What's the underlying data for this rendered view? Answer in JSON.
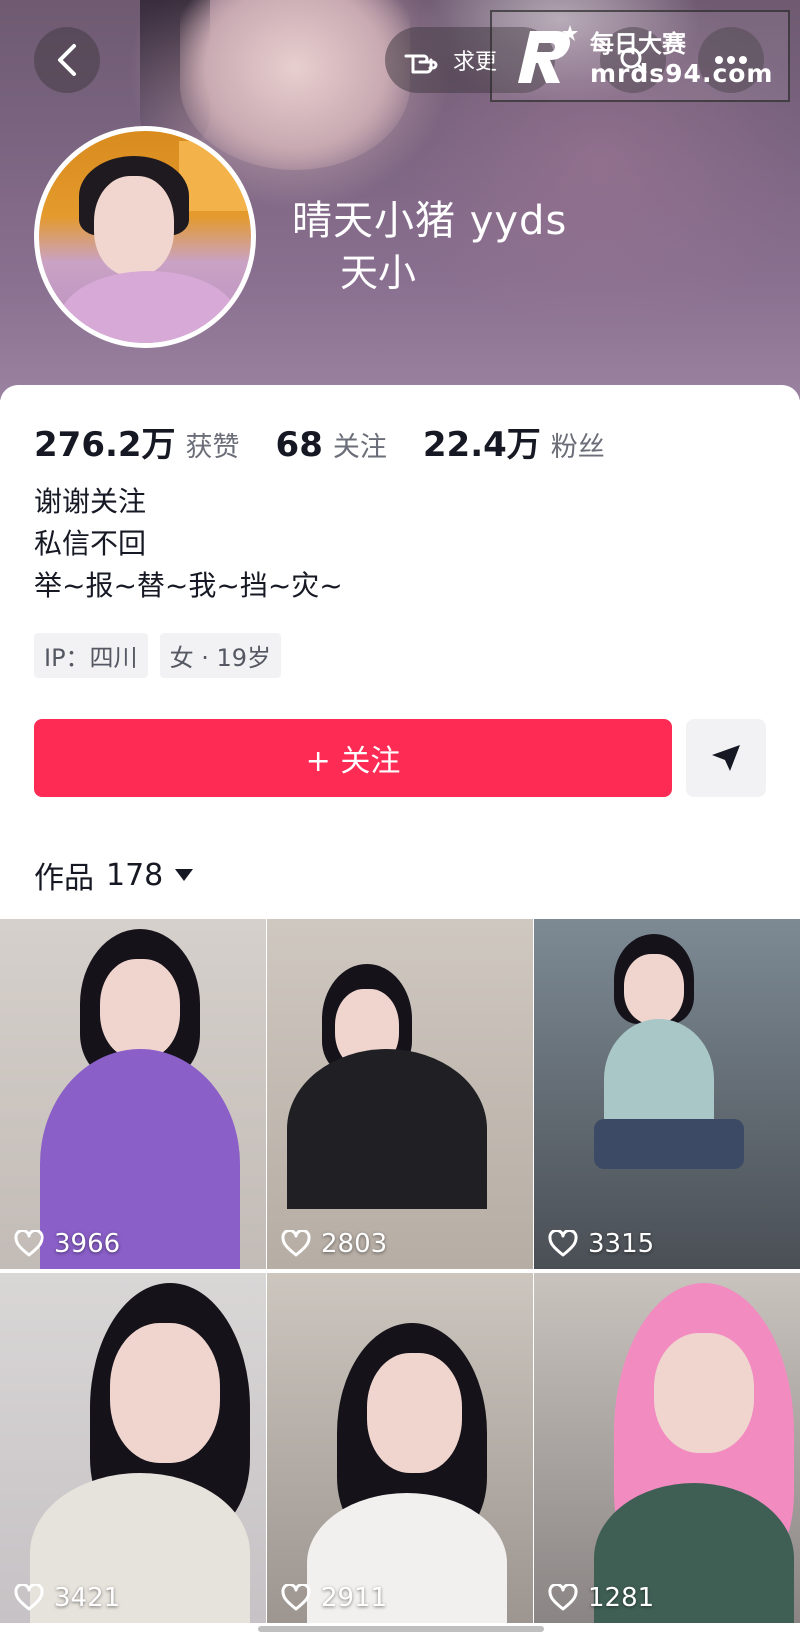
{
  "header": {
    "seek_label": "求更",
    "watermark": {
      "line1": "每日大赛",
      "line2": "mrds94.com"
    }
  },
  "profile": {
    "nickname": "晴天小猪 yyds",
    "handle": "天小",
    "stats": [
      {
        "value": "276.2万",
        "label": "获赞"
      },
      {
        "value": "68",
        "label": "关注"
      },
      {
        "value": "22.4万",
        "label": "粉丝"
      }
    ],
    "bio": [
      "谢谢关注",
      "私信不回",
      "举~报~替~我~挡~灾~"
    ],
    "tags": [
      "IP：四川",
      "女 · 19岁"
    ],
    "follow_label": "+ 关注"
  },
  "works": {
    "label": "作品",
    "count": "178",
    "items": [
      {
        "likes": "3966"
      },
      {
        "likes": "2803"
      },
      {
        "likes": "3315"
      },
      {
        "likes": "3421"
      },
      {
        "likes": "2911"
      },
      {
        "likes": "1281"
      }
    ]
  },
  "colors": {
    "accent": "#fe2c55",
    "text_primary": "#161823",
    "text_secondary": "#6b6e78",
    "chip_bg": "#f2f2f4"
  }
}
